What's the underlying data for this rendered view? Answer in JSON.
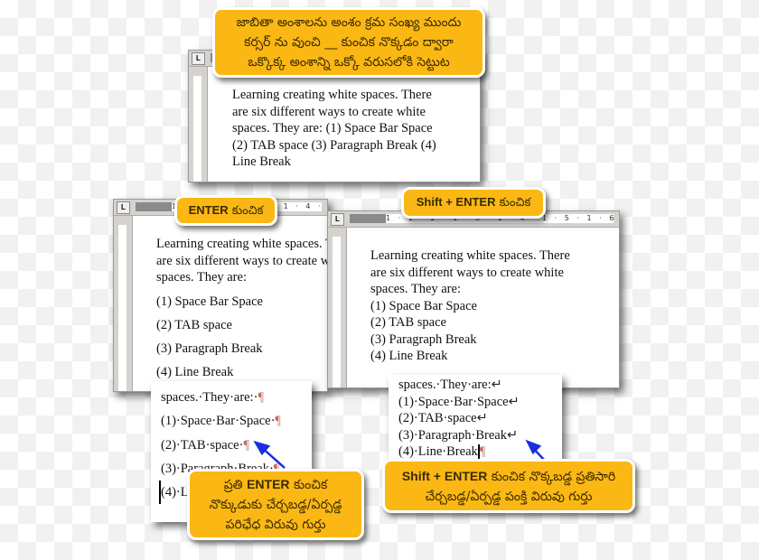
{
  "top_callout": {
    "lines": [
      "జాబితా అంశాలను అంశం క్రమ సంఖ్య ముందు",
      "కర్సర్ ను వుంచి __ కుంచిక నొక్కడం ద్వారా",
      "ఒక్కొక్క అంశాన్ని ఒక్కో వరుసలోకి సెట్టుట"
    ]
  },
  "top_doc": {
    "lines": [
      "Learning creating white spaces.  There",
      "are six different ways to create white",
      "spaces. They are: (1) Space Bar Space",
      "(2) TAB space (3) Paragraph Break (4)",
      "Line Break"
    ]
  },
  "enter_label": {
    "key": "ENTER",
    "word": "కుంచిక"
  },
  "shift_enter_label": {
    "key": "Shift + ENTER",
    "word": "కుంచిక"
  },
  "ruler": {
    "ticks": "1 · 1 · 2 · 1 · 3 · 1 · 4 · 1 · 5 · 1 · 6 · 1"
  },
  "enter_doc": {
    "lines": [
      "Learning creating white spaces.  There",
      "are six different ways to create white",
      "spaces. They are:",
      "(1) Space Bar Space",
      "(2) TAB space",
      "(3) Paragraph Break",
      "(4) Line Break"
    ]
  },
  "shift_doc": {
    "lines": [
      "Learning creating white spaces.  There",
      "are six different ways to create white",
      "spaces. They are:",
      "(1) Space Bar Space",
      "(2) TAB space",
      "(3) Paragraph Break",
      "(4) Line Break"
    ]
  },
  "enter_zoom": {
    "lines": [
      "spaces.·They·are:·",
      "(1)·Space·Bar·Space·",
      "(2)·TAB·space·",
      "(3)·Paragraph·Break·",
      "(4)·L"
    ],
    "mark": "¶"
  },
  "shift_zoom": {
    "lines": [
      "spaces.·They·are:",
      "(1)·Space·Bar·Space",
      "(2)·TAB·space",
      "(3)·Paragraph·Break",
      "(4)·Line·Break"
    ],
    "mark": "↵",
    "end_mark": "¶"
  },
  "enter_callout": {
    "key": "ENTER",
    "line1": "ప్రతి",
    "line1b": "కుంచిక",
    "line2": "నొక్కుడుకు చేర్చబడ్డ/ఏర్పడ్డ",
    "line3": "పరిఛేధ విరువు గుర్తు"
  },
  "shift_callout": {
    "key": "Shift + ENTER",
    "line1b": "కుంచిక నొక్కబడ్డ ప్రతిసారి",
    "line2": "చేర్చబడ్డ/ఏర్పడ్డ పంక్తి విరువు గుర్తు"
  },
  "colors": {
    "callout": "#fbb814",
    "arrow": "#1a2ee0"
  }
}
